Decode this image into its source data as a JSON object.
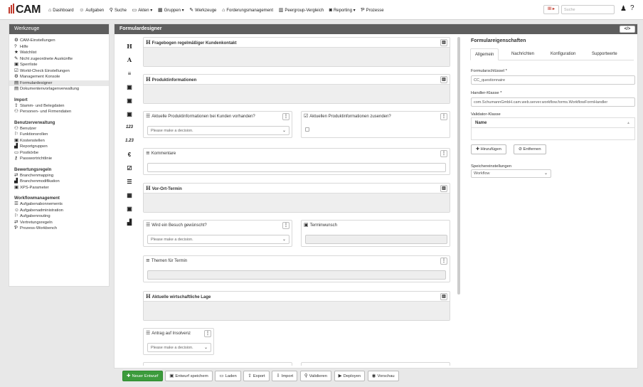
{
  "app": {
    "logo": "CAM"
  },
  "nav": [
    {
      "icon": "home-icon",
      "glyph": "⌂",
      "label": "Dashboard"
    },
    {
      "icon": "tasks-icon",
      "glyph": "☺",
      "label": "Aufgaben"
    },
    {
      "icon": "search-icon",
      "glyph": "⚲",
      "label": "Suche"
    },
    {
      "icon": "folder-icon",
      "glyph": "▭",
      "label": "Akten ▾"
    },
    {
      "icon": "groups-icon",
      "glyph": "▦",
      "label": "Gruppen ▾"
    },
    {
      "icon": "tools-icon",
      "glyph": "✎",
      "label": "Werkzeuge"
    },
    {
      "icon": "bank-icon",
      "glyph": "⌂",
      "label": "Forderungsmanagement"
    },
    {
      "icon": "bar-chart-icon",
      "glyph": "▥",
      "label": "Peergroup-Vergleich"
    },
    {
      "icon": "camera-icon",
      "glyph": "◙",
      "label": "Reporting ▾"
    },
    {
      "icon": "process-icon",
      "glyph": "Ƥ",
      "label": "Prozesse"
    }
  ],
  "topright": {
    "search_placeholder": "Suche",
    "chip": "Ill ▸"
  },
  "left": {
    "title": "Werkzeuge",
    "items1": [
      {
        "icon": "gear-icon",
        "glyph": "⚙",
        "label": "CAM-Einstellungen"
      },
      {
        "icon": "help-icon",
        "glyph": "?",
        "label": "Hilfe"
      },
      {
        "icon": "star-icon",
        "glyph": "★",
        "label": "Watchlist"
      },
      {
        "icon": "edit-icon",
        "glyph": "✎",
        "label": "Nicht zugeordnete Auskünfte"
      },
      {
        "icon": "lock-icon",
        "glyph": "▣",
        "label": "Sperrliste"
      },
      {
        "icon": "check-icon",
        "glyph": "☑",
        "label": "World-Check Einstellungen"
      },
      {
        "icon": "cogs-icon",
        "glyph": "⚙",
        "label": "Management Konsole"
      },
      {
        "icon": "form-icon",
        "glyph": "▤",
        "label": "Formulardesigner"
      },
      {
        "icon": "file-icon",
        "glyph": "▤",
        "label": "Dokumentenvorlagenverwaltung"
      }
    ],
    "sec_import": "Import",
    "items2": [
      {
        "icon": "upload-icon",
        "glyph": "⇪",
        "label": "Stamm- und Belegdaten"
      },
      {
        "icon": "user-plus-icon",
        "glyph": "⚇",
        "label": "Personen- und Firmendaten"
      }
    ],
    "sec_benutzer": "Benutzerverwaltung",
    "items3": [
      {
        "icon": "users-icon",
        "glyph": "⚇",
        "label": "Benutzer"
      },
      {
        "icon": "sitemap-icon",
        "glyph": "⚐",
        "label": "Funktionsrollen"
      },
      {
        "icon": "cost-icon",
        "glyph": "▣",
        "label": "Kostenstellen"
      },
      {
        "icon": "chart-icon",
        "glyph": "▟",
        "label": "Reportgruppen"
      },
      {
        "icon": "inbox-icon",
        "glyph": "▭",
        "label": "Postkörbe"
      },
      {
        "icon": "key-icon",
        "glyph": "⚷",
        "label": "Passwortrichtlinie"
      }
    ],
    "sec_bewertung": "Bewertungsregeln",
    "items4": [
      {
        "icon": "map-icon",
        "glyph": "⇄",
        "label": "Branchenmapping"
      },
      {
        "icon": "industry-icon",
        "glyph": "▟",
        "label": "Branchenmodifikation"
      },
      {
        "icon": "xps-icon",
        "glyph": "▣",
        "label": "XPS-Parameter"
      }
    ],
    "sec_workflow": "Workflowmanagement",
    "items5": [
      {
        "icon": "list-icon",
        "glyph": "☰",
        "label": "Aufgabenabonnements"
      },
      {
        "icon": "admin-icon",
        "glyph": "☺",
        "label": "Aufgabenadministration"
      },
      {
        "icon": "routing-icon",
        "glyph": "⚐",
        "label": "Aufgabenrouting"
      },
      {
        "icon": "exchange-icon",
        "glyph": "⇄",
        "label": "Vertretungsregeln"
      },
      {
        "icon": "process-icon",
        "glyph": "Ƥ",
        "label": "Prozess-Workbench"
      }
    ]
  },
  "main": {
    "title": "Formulardesigner",
    "code_btn": "</>",
    "palette": [
      "H",
      "A",
      "≡",
      "▣",
      "▣",
      "▣",
      "123",
      "1.23",
      "€",
      "☑",
      "☰",
      "▦",
      "▣",
      "▟"
    ],
    "cards": {
      "c1": "Fragebogen regelmäßiger Kundenkontakt",
      "c2": "Produktinformationen",
      "c3": "Aktuelle Produktinformationen bei Kunden vorhanden?",
      "c4": "Aktuellen Produktinformationen zusenden?",
      "c5": "Kommentare",
      "c6": "Vor-Ort-Termin",
      "c7": "Wird ein Besuch gewünscht?",
      "c8": "Terminwunsch",
      "c9": "Themen für Termin",
      "c10": "Aktuelle wirtschaftliche Lage",
      "c11": "Antrag auf Insolvenz"
    },
    "select_placeholder": "Please make a decision."
  },
  "right": {
    "title": "Formulareigenschaften",
    "tabs": [
      "Allgemein",
      "Nachrichten",
      "Konfiguration",
      "Supportwerte"
    ],
    "key_label": "Formularschlüssel *",
    "key_value": "CC_questionnaire",
    "handler_label": "Handler-Klasse *",
    "handler_value": "com.SchumannGmbH.cam.web.server.workflow.forms.WorkflowFormHandler",
    "validator_label": "Validator-Klasse",
    "name_col": "Name",
    "add_btn": "Hinzufügen",
    "remove_btn": "Entfernen",
    "storage_label": "Speichereinstellungen",
    "storage_value": "Workflow"
  },
  "toolbar": [
    {
      "icon": "plus-icon",
      "glyph": "✚",
      "label": "Neuer Entwurf"
    },
    {
      "icon": "save-icon",
      "glyph": "▣",
      "label": "Entwurf speichern"
    },
    {
      "icon": "folder-open-icon",
      "glyph": "▭",
      "label": "Laden"
    },
    {
      "icon": "export-icon",
      "glyph": "⇪",
      "label": "Export"
    },
    {
      "icon": "import-icon",
      "glyph": "⇩",
      "label": "Import"
    },
    {
      "icon": "validate-icon",
      "glyph": "⚲",
      "label": "Validieren"
    },
    {
      "icon": "play-icon",
      "glyph": "▶",
      "label": "Deployen"
    },
    {
      "icon": "eye-icon",
      "glyph": "◉",
      "label": "Vorschau"
    }
  ]
}
